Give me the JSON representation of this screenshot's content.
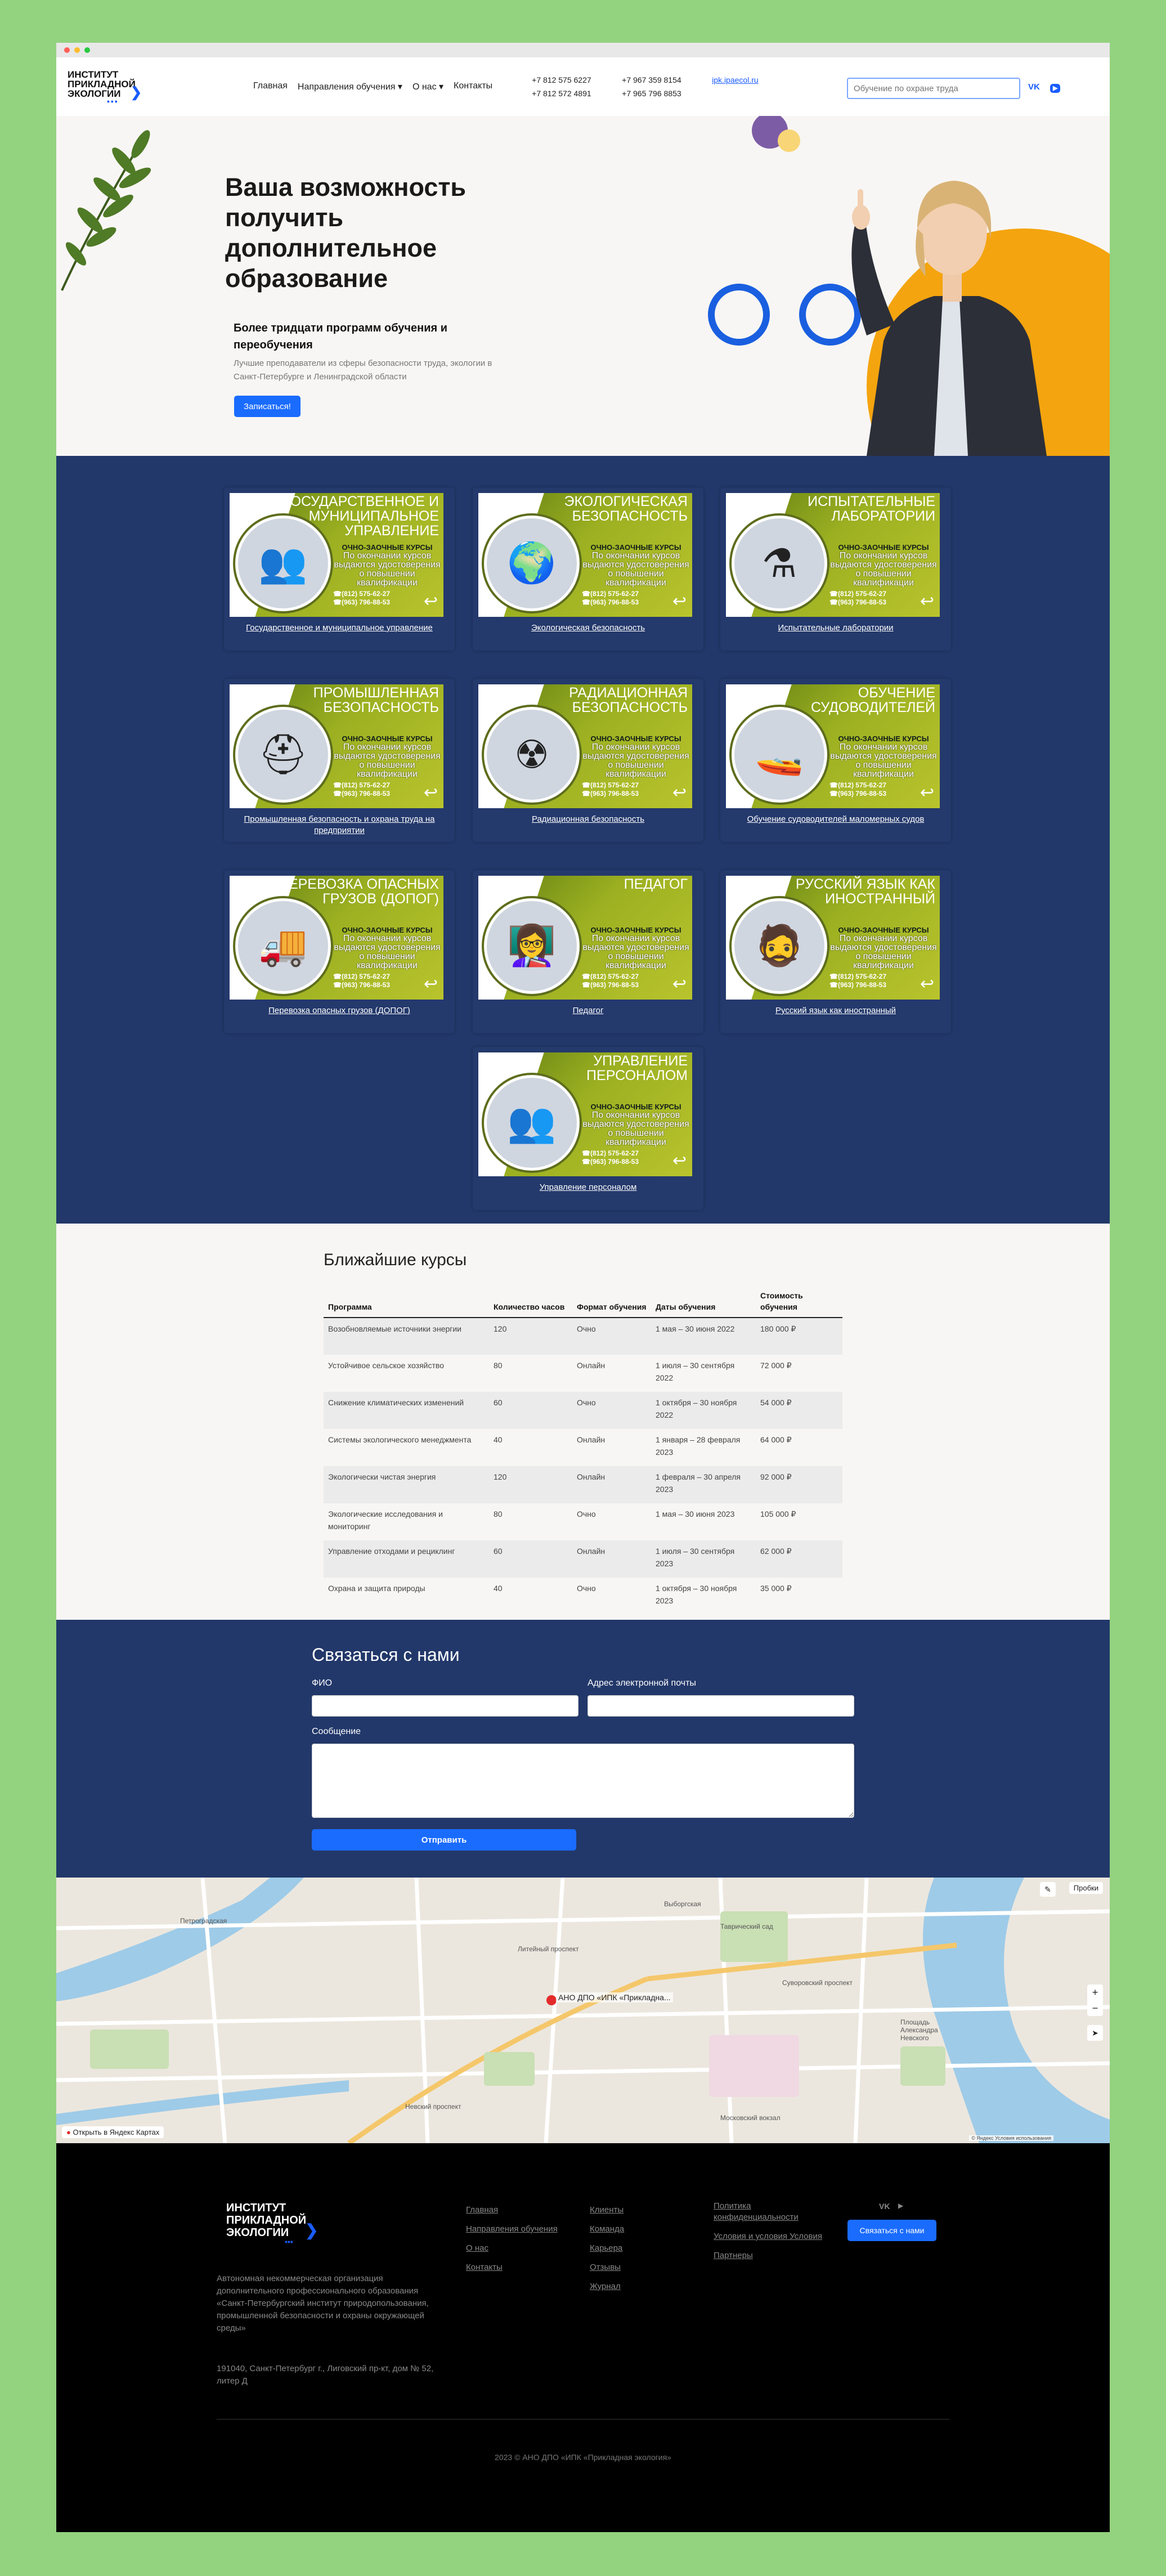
{
  "colors": {
    "page_bg": "#93d27f",
    "navy": "#22386a",
    "accent_blue": "#1a6cff",
    "banner_green": "#9cb021",
    "hero_yellow": "#f4a40e"
  },
  "header": {
    "logo_text": [
      "ИНСТИТУТ",
      "ПРИКЛАДНОЙ",
      "ЭКОЛОГИИ"
    ],
    "nav": [
      "Главная",
      "Направления обучения ▾",
      "О нас ▾",
      "Контакты"
    ],
    "phones": [
      "+7 812 575 6227",
      "+7 967 359 8154",
      "+7 812 572 4891",
      "+7 965 796 8853"
    ],
    "email": "ipk.ipaecol.ru",
    "search_placeholder": "Обучение по охране труда",
    "social": [
      "vk-icon",
      "youtube-icon"
    ]
  },
  "hero": {
    "title": "Ваша возможность получить дополнительное образование",
    "subtitle": "Более тридцати программ обучения и переобучения",
    "text": "Лучшие преподаватели из сферы безопасности труда, экологии в Санкт-Петербурге и Ленинградской области",
    "button": "Записаться!"
  },
  "banner_common": {
    "line1": "ОЧНО-ЗАОЧНЫЕ КУРСЫ",
    "line2": "По окончании курсов выдаются удостоверения о повышении квалификации",
    "phone1": "☎(812) 575-62-27",
    "phone2": "☎(963) 796-88-53"
  },
  "directions": [
    {
      "banner": "Государственное и муниципальное управление",
      "caption": "Государственное и муниципальное управление",
      "icon": "👥"
    },
    {
      "banner": "Экологическая безопасность",
      "caption": "Экологическая безопасность",
      "icon": "🌍"
    },
    {
      "banner": "Испытательные лаборатории",
      "caption": "Испытательные лаборатории",
      "icon": "⚗"
    },
    {
      "banner": "Промышленная безопасность",
      "caption": "Промышленная безопасность и охрана труда на предприятии",
      "icon": "⛑"
    },
    {
      "banner": "Радиационная безопасность",
      "caption": "Радиационная безопасность",
      "icon": "☢"
    },
    {
      "banner": "Обучение судоводителей",
      "caption": "Обучение судоводителей маломерных судов",
      "icon": "🚤"
    },
    {
      "banner": "Перевозка опасных грузов (ДОПОГ)",
      "caption": "Перевозка опасных грузов (ДОПОГ)",
      "icon": "🚚"
    },
    {
      "banner": "Педагог",
      "caption": "Педагог",
      "icon": "👩‍🏫"
    },
    {
      "banner": "Русский язык как иностранный",
      "caption": "Русский язык как иностранный",
      "icon": "🧔"
    },
    {
      "banner": "Управление персоналом",
      "caption": "Управление персоналом",
      "icon": "👥"
    }
  ],
  "courses": {
    "title": "Ближайшие курсы",
    "headers": [
      "Программа",
      "Количество часов",
      "Формат обучения",
      "Даты обучения",
      "Стоимость обучения"
    ],
    "rows": [
      [
        "Возобновляемые источники энергии",
        "120",
        "Очно",
        "1 мая – 30 июня 2022",
        "180 000 ₽"
      ],
      [
        "Устойчивое сельское хозяйство",
        "80",
        "Онлайн",
        "1 июля – 30 сентября 2022",
        "72 000 ₽"
      ],
      [
        "Снижение климатических изменений",
        "60",
        "Очно",
        "1 октября – 30 ноября 2022",
        "54 000 ₽"
      ],
      [
        "Системы экологического менеджмента",
        "40",
        "Онлайн",
        "1 января – 28 февраля 2023",
        "64 000 ₽"
      ],
      [
        "Экологически чистая энергия",
        "120",
        "Онлайн",
        "1 февраля – 30 апреля 2023",
        "92 000 ₽"
      ],
      [
        "Экологические исследования и мониторинг",
        "80",
        "Очно",
        "1 мая – 30 июня 2023",
        "105 000 ₽"
      ],
      [
        "Управление отходами и рециклинг",
        "60",
        "Онлайн",
        "1 июля – 30 сентября 2023",
        "62 000 ₽"
      ],
      [
        "Охрана и защита природы",
        "40",
        "Очно",
        "1 октября – 30 ноября 2023",
        "35 000 ₽"
      ]
    ]
  },
  "contact": {
    "title": "Связаться с нами",
    "name_label": "ФИО",
    "email_label": "Адрес электронной почты",
    "message_label": "Сообщение",
    "submit": "Отправить"
  },
  "map": {
    "pin_label": "АНО ДПО «ИПК «Прикладна...",
    "open_link": "Открыть в Яндекс Картах",
    "traffic": "Пробки",
    "copyright": "© Яндекс   Условия использования",
    "streets": [
      "Петроградская",
      "Литейный проспект",
      "Невский проспект",
      "Суворовский проспект",
      "Выборгская",
      "Площадь Александра Невского",
      "Таврический сад",
      "Московский вокзал"
    ]
  },
  "footer": {
    "logo_text": [
      "ИНСТИТУТ",
      "ПРИКЛАДНОЙ",
      "ЭКОЛОГИИ"
    ],
    "description": "Автономная некоммерческая организация дополнительного профессионального образования «Санкт-Петербургский институт природопользования, промышленной безопасности и охраны окружающей среды»",
    "address": "191040, Санкт-Петербург г., Лиговский пр-кт, дом № 52, литер Д",
    "col1": [
      "Главная",
      "Направления обучения",
      "О нас",
      "Контакты"
    ],
    "col2": [
      "Клиенты",
      "Команда",
      "Карьера",
      "Отзывы",
      "Журнал"
    ],
    "col3": [
      "Политика конфиденциальности",
      "Условия и условия Условия",
      "Партнеры"
    ],
    "button": "Связаться с нами",
    "copyright": "2023 © АНО ДПО «ИПК «Прикладная экология»"
  }
}
